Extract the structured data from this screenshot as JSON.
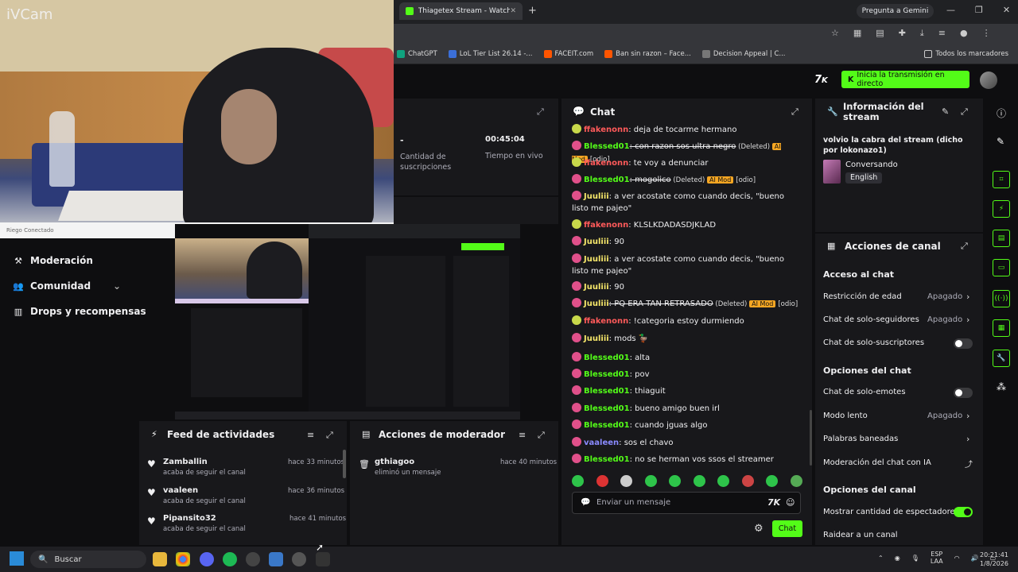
{
  "webcam": {
    "label": "iVCam",
    "bar_text": "Riego Conectado"
  },
  "browser": {
    "tab_title": "Thiagetex Stream - Watch Live",
    "gemini_label": "Pregunta a Gemini",
    "bookmarks": [
      {
        "label": "ChatGPT",
        "color": "#10a37f"
      },
      {
        "label": "LoL Tier List 26.14 -...",
        "color": "#3b6fd8"
      },
      {
        "label": "FACEIT.com",
        "color": "#ff5500"
      },
      {
        "label": "Ban sin razon – Face...",
        "color": "#ff5500"
      },
      {
        "label": "Decision Appeal | C...",
        "color": "#777777"
      }
    ],
    "all_bookmarks": "Todos los marcadores"
  },
  "kick": {
    "logo": "7",
    "golive_label": "Inicia la transmisión en directo",
    "accent": "#53fc18"
  },
  "nav": {
    "items": [
      {
        "label": "Moderación",
        "icon": "gavel-icon"
      },
      {
        "label": "Comunidad",
        "icon": "people-icon"
      },
      {
        "label": "Drops y recompensas",
        "icon": "chart-icon"
      }
    ]
  },
  "stats": {
    "dash": "-",
    "subs_label": "Cantidad de suscripciones",
    "time_value": "00:45:04",
    "time_label": "Tiempo en vivo"
  },
  "feed": {
    "title": "Feed de actividades",
    "items": [
      {
        "name": "Zamballin",
        "sub": "acaba de seguir el canal",
        "time": "hace 33 minutos"
      },
      {
        "name": "vaaleen",
        "sub": "acaba de seguir el canal",
        "time": "hace 36 minutos"
      },
      {
        "name": "Pipansito32",
        "sub": "acaba de seguir el canal",
        "time": "hace 41 minutos"
      }
    ]
  },
  "modactions": {
    "title": "Acciones de moderador",
    "items": [
      {
        "name": "gthiagoo",
        "sub": "eliminó un mensaje",
        "time": "hace 40 minutos"
      }
    ]
  },
  "chat": {
    "title": "Chat",
    "placeholder": "Enviar un mensaje",
    "send_label": "Chat",
    "messages": [
      {
        "user": "ffakenonn",
        "color": "#ff5a5a",
        "text": ": deja de tocarme hermano"
      },
      {
        "user": "Blessed01",
        "color": "#53fc18",
        "text": ": con razon sos ultra negro",
        "deleted": true,
        "mod": "AI Mod",
        "tag": "[odio]"
      },
      {
        "user": "ffakenonn",
        "color": "#ff5a5a",
        "text": ": te voy a denunciar"
      },
      {
        "user": "Blessed01",
        "color": "#53fc18",
        "text": ": mogolico",
        "deleted": true,
        "mod": "AI Mod",
        "tag": "[odio]"
      },
      {
        "user": "Juuliii",
        "color": "#f5e66a",
        "text": ": a ver acostate como cuando decis, \"bueno listo me pajeo\""
      },
      {
        "user": "ffakenonn",
        "color": "#ff5a5a",
        "text": ": KLSLKDADASDJKLAD"
      },
      {
        "user": "Juuliii",
        "color": "#f5e66a",
        "text": ": 90"
      },
      {
        "user": "Juuliii",
        "color": "#f5e66a",
        "text": ": a ver acostate como cuando decis, \"bueno listo me pajeo\""
      },
      {
        "user": "Juuliii",
        "color": "#f5e66a",
        "text": ": 90"
      },
      {
        "user": "Juuliii",
        "color": "#f5e66a",
        "text": ": PQ ERA TAN RETRASADO",
        "deleted": true,
        "mod": "AI Mod",
        "tag": "[odio]"
      },
      {
        "user": "ffakenonn",
        "color": "#ff5a5a",
        "text": ": !categoria estoy durmiendo"
      },
      {
        "user": "Juuliii",
        "color": "#f5e66a",
        "text": ": mods 🦆"
      },
      {
        "user": "Blessed01",
        "color": "#53fc18",
        "text": ": alta"
      },
      {
        "user": "Blessed01",
        "color": "#53fc18",
        "text": ": pov"
      },
      {
        "user": "Blessed01",
        "color": "#53fc18",
        "text": ": thiaguit"
      },
      {
        "user": "Blessed01",
        "color": "#53fc18",
        "text": ": bueno amigo buen irl"
      },
      {
        "user": "Blessed01",
        "color": "#53fc18",
        "text": ": cuando jguas algo"
      },
      {
        "user": "vaaleen",
        "color": "#8a8aff",
        "text": ": sos el chavo"
      },
      {
        "user": "Blessed01",
        "color": "#53fc18",
        "text": ": no se herman vos ssos el streamer"
      }
    ],
    "deleted_label": "(Deleted)"
  },
  "info": {
    "title": "Información del stream",
    "stream_title": "volvio la cabra del stream (dicho por lokonazo1)",
    "category": "Conversando",
    "language": "English"
  },
  "channel_actions": {
    "title": "Acciones de canal",
    "chat_access": "Acceso al chat",
    "age_restriction": "Restricción de edad",
    "followers_only": "Chat de solo-seguidores",
    "subs_only": "Chat de solo-suscriptores",
    "off": "Apagado",
    "chat_options": "Opciones del chat",
    "emotes_only": "Chat de solo-emotes",
    "slow_mode": "Modo lento",
    "banned_words": "Palabras baneadas",
    "ai_moderation": "Moderación del chat con IA",
    "channel_options": "Opciones del canal",
    "show_viewers": "Mostrar cantidad de espectadores",
    "raid": "Raidear a un canal"
  },
  "taskbar": {
    "search": "Buscar",
    "lang": "ESP",
    "lang2": "LAA",
    "time": "20:21:41",
    "date": "1/8/2026"
  }
}
